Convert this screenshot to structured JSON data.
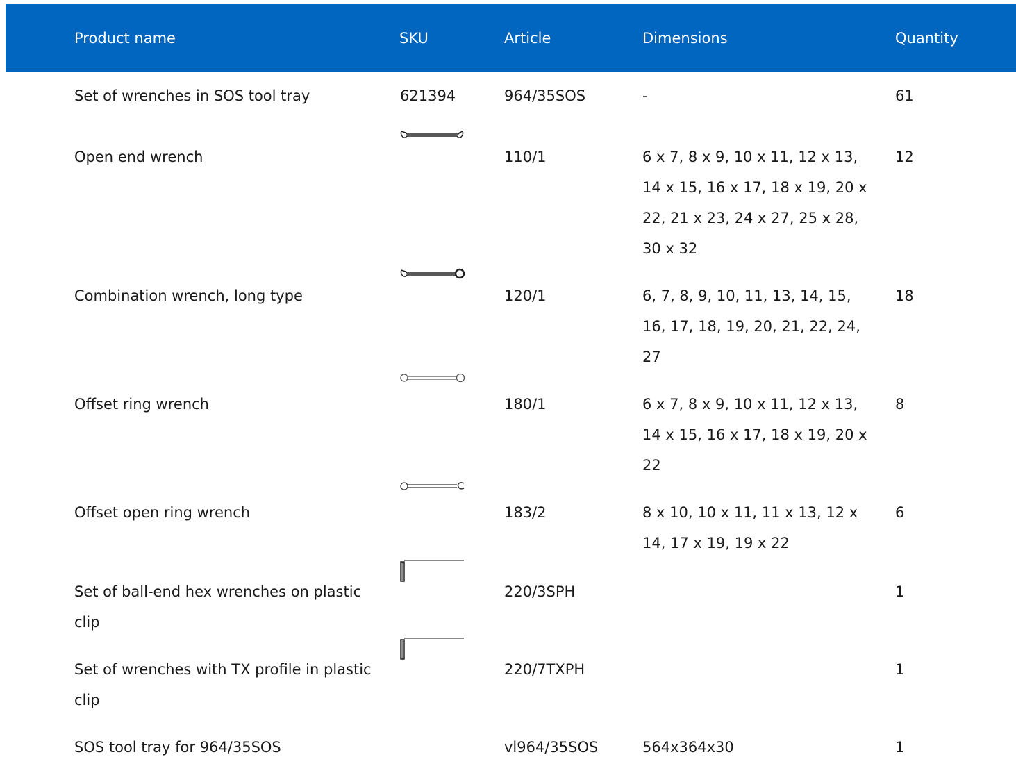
{
  "columns": {
    "name": "Product name",
    "sku": "SKU",
    "article": "Article",
    "dimensions": "Dimensions",
    "quantity": "Quantity"
  },
  "rows": [
    {
      "name": "Set of wrenches in SOS tool tray",
      "sku": "621394",
      "article": "964/35SOS",
      "dimensions": "-",
      "quantity": "61"
    },
    {
      "name": "Open end wrench",
      "sku_icon": "open-end-wrench-icon",
      "article": "110/1",
      "dimensions": "6 x 7, 8 x 9, 10 x 11, 12 x 13, 14 x 15, 16 x 17, 18 x 19, 20 x 22, 21 x 23, 24 x 27, 25 x 28, 30 x 32",
      "quantity": "12"
    },
    {
      "name": "Combination wrench, long type",
      "sku_icon": "combination-wrench-icon",
      "article": "120/1",
      "dimensions": "6, 7, 8, 9, 10, 11, 13, 14, 15, 16, 17, 18, 19, 20, 21, 22, 24, 27",
      "quantity": "18"
    },
    {
      "name": "Offset ring wrench",
      "sku_icon": "offset-ring-wrench-icon",
      "article": "180/1",
      "dimensions": "6 x 7, 8 x 9, 10 x 11, 12 x 13, 14 x 15, 16 x 17, 18 x 19, 20 x 22",
      "quantity": "8"
    },
    {
      "name": "Offset open ring wrench",
      "sku_icon": "offset-open-ring-wrench-icon",
      "article": "183/2",
      "dimensions": "8 x 10, 10 x 11, 11 x 13, 12 x 14, 17 x 19, 19 x 22",
      "quantity": "6"
    },
    {
      "name": "Set of ball-end hex wrenches on plastic clip",
      "sku_icon": "hex-key-icon",
      "article": "220/3SPH",
      "dimensions": "",
      "quantity": "1"
    },
    {
      "name": "Set of wrenches with TX profile in plastic clip",
      "sku_icon": "tx-key-icon",
      "article": "220/7TXPH",
      "dimensions": "",
      "quantity": "1"
    },
    {
      "name": "SOS tool tray for 964/35SOS",
      "sku": "",
      "article": "vl964/35SOS",
      "dimensions": "564x364x30",
      "quantity": "1"
    }
  ]
}
